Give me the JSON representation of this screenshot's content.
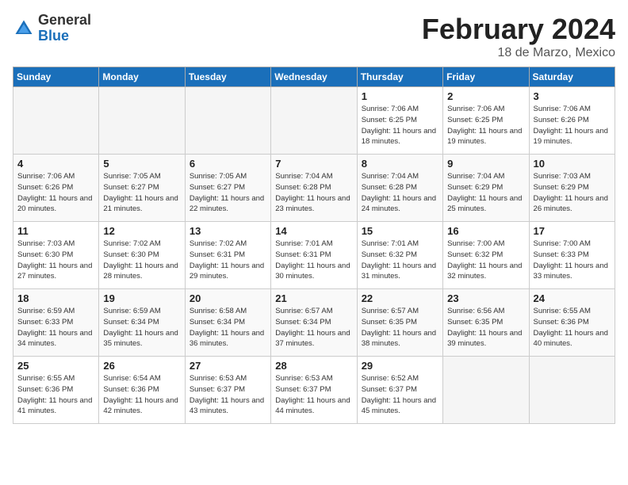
{
  "header": {
    "logo_general": "General",
    "logo_blue": "Blue",
    "title": "February 2024",
    "subtitle": "18 de Marzo, Mexico"
  },
  "days_of_week": [
    "Sunday",
    "Monday",
    "Tuesday",
    "Wednesday",
    "Thursday",
    "Friday",
    "Saturday"
  ],
  "weeks": [
    [
      {
        "day": "",
        "empty": true
      },
      {
        "day": "",
        "empty": true
      },
      {
        "day": "",
        "empty": true
      },
      {
        "day": "",
        "empty": true
      },
      {
        "day": "1",
        "sunrise": "7:06 AM",
        "sunset": "6:25 PM",
        "daylight": "11 hours and 18 minutes."
      },
      {
        "day": "2",
        "sunrise": "7:06 AM",
        "sunset": "6:25 PM",
        "daylight": "11 hours and 19 minutes."
      },
      {
        "day": "3",
        "sunrise": "7:06 AM",
        "sunset": "6:26 PM",
        "daylight": "11 hours and 19 minutes."
      }
    ],
    [
      {
        "day": "4",
        "sunrise": "7:06 AM",
        "sunset": "6:26 PM",
        "daylight": "11 hours and 20 minutes."
      },
      {
        "day": "5",
        "sunrise": "7:05 AM",
        "sunset": "6:27 PM",
        "daylight": "11 hours and 21 minutes."
      },
      {
        "day": "6",
        "sunrise": "7:05 AM",
        "sunset": "6:27 PM",
        "daylight": "11 hours and 22 minutes."
      },
      {
        "day": "7",
        "sunrise": "7:04 AM",
        "sunset": "6:28 PM",
        "daylight": "11 hours and 23 minutes."
      },
      {
        "day": "8",
        "sunrise": "7:04 AM",
        "sunset": "6:28 PM",
        "daylight": "11 hours and 24 minutes."
      },
      {
        "day": "9",
        "sunrise": "7:04 AM",
        "sunset": "6:29 PM",
        "daylight": "11 hours and 25 minutes."
      },
      {
        "day": "10",
        "sunrise": "7:03 AM",
        "sunset": "6:29 PM",
        "daylight": "11 hours and 26 minutes."
      }
    ],
    [
      {
        "day": "11",
        "sunrise": "7:03 AM",
        "sunset": "6:30 PM",
        "daylight": "11 hours and 27 minutes."
      },
      {
        "day": "12",
        "sunrise": "7:02 AM",
        "sunset": "6:30 PM",
        "daylight": "11 hours and 28 minutes."
      },
      {
        "day": "13",
        "sunrise": "7:02 AM",
        "sunset": "6:31 PM",
        "daylight": "11 hours and 29 minutes."
      },
      {
        "day": "14",
        "sunrise": "7:01 AM",
        "sunset": "6:31 PM",
        "daylight": "11 hours and 30 minutes."
      },
      {
        "day": "15",
        "sunrise": "7:01 AM",
        "sunset": "6:32 PM",
        "daylight": "11 hours and 31 minutes."
      },
      {
        "day": "16",
        "sunrise": "7:00 AM",
        "sunset": "6:32 PM",
        "daylight": "11 hours and 32 minutes."
      },
      {
        "day": "17",
        "sunrise": "7:00 AM",
        "sunset": "6:33 PM",
        "daylight": "11 hours and 33 minutes."
      }
    ],
    [
      {
        "day": "18",
        "sunrise": "6:59 AM",
        "sunset": "6:33 PM",
        "daylight": "11 hours and 34 minutes."
      },
      {
        "day": "19",
        "sunrise": "6:59 AM",
        "sunset": "6:34 PM",
        "daylight": "11 hours and 35 minutes."
      },
      {
        "day": "20",
        "sunrise": "6:58 AM",
        "sunset": "6:34 PM",
        "daylight": "11 hours and 36 minutes."
      },
      {
        "day": "21",
        "sunrise": "6:57 AM",
        "sunset": "6:34 PM",
        "daylight": "11 hours and 37 minutes."
      },
      {
        "day": "22",
        "sunrise": "6:57 AM",
        "sunset": "6:35 PM",
        "daylight": "11 hours and 38 minutes."
      },
      {
        "day": "23",
        "sunrise": "6:56 AM",
        "sunset": "6:35 PM",
        "daylight": "11 hours and 39 minutes."
      },
      {
        "day": "24",
        "sunrise": "6:55 AM",
        "sunset": "6:36 PM",
        "daylight": "11 hours and 40 minutes."
      }
    ],
    [
      {
        "day": "25",
        "sunrise": "6:55 AM",
        "sunset": "6:36 PM",
        "daylight": "11 hours and 41 minutes."
      },
      {
        "day": "26",
        "sunrise": "6:54 AM",
        "sunset": "6:36 PM",
        "daylight": "11 hours and 42 minutes."
      },
      {
        "day": "27",
        "sunrise": "6:53 AM",
        "sunset": "6:37 PM",
        "daylight": "11 hours and 43 minutes."
      },
      {
        "day": "28",
        "sunrise": "6:53 AM",
        "sunset": "6:37 PM",
        "daylight": "11 hours and 44 minutes."
      },
      {
        "day": "29",
        "sunrise": "6:52 AM",
        "sunset": "6:37 PM",
        "daylight": "11 hours and 45 minutes."
      },
      {
        "day": "",
        "empty": true
      },
      {
        "day": "",
        "empty": true
      }
    ]
  ]
}
